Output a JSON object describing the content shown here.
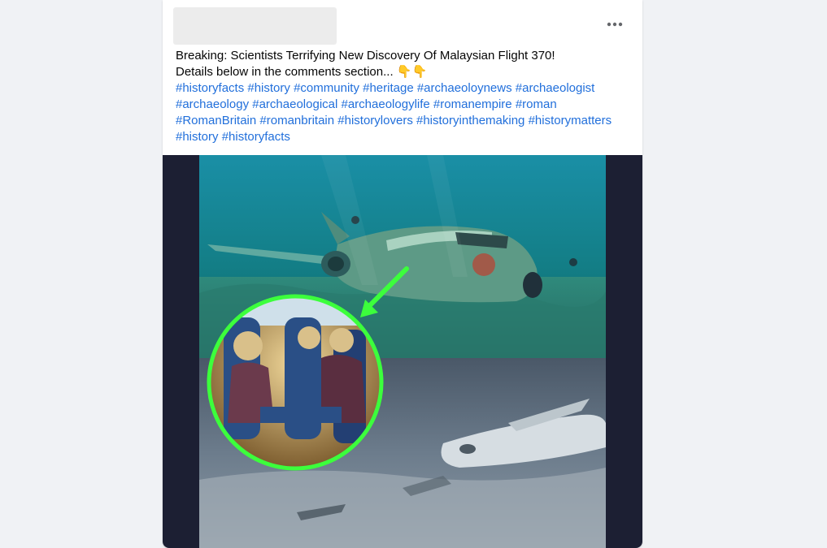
{
  "post": {
    "headline": "Breaking: Scientists Terrifying New Discovery Of Malaysian Flight 370!",
    "subline": "Details below in the comments section...",
    "emoji": "👇👇",
    "hashtags": [
      [
        "#historyfacts",
        "#history",
        "#community",
        "#heritage",
        "#archaeoloynews",
        "#archaeologist"
      ],
      [
        "#archaeology",
        "#archaeological",
        "#archaeologylife",
        "#romanempire",
        "#roman"
      ],
      [
        "#RomanBritain",
        "#romanbritain",
        "#historylovers",
        "#historyinthemaking",
        "#historymatters"
      ],
      [
        "#history",
        "#historyfacts"
      ]
    ],
    "more_icon": "more-horizontal-icon",
    "media_description_icon": "post-image"
  },
  "colors": {
    "page_background": "#f0f2f5",
    "card_background": "#ffffff",
    "hashtag": "#216fdb",
    "media_background": "#1c1f33",
    "highlight_ring": "#3cff3c"
  }
}
